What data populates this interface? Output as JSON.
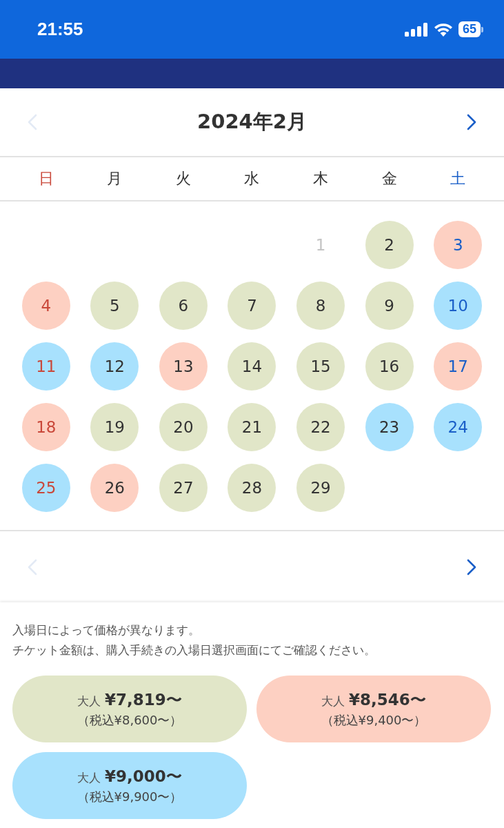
{
  "status_bar": {
    "time": "21:55",
    "battery": "65"
  },
  "calendar": {
    "month": "2024年2月",
    "prev_enabled": false,
    "next_enabled": true,
    "weekdays": [
      {
        "label": "日",
        "kind": "sunday"
      },
      {
        "label": "月",
        "kind": "weekday"
      },
      {
        "label": "火",
        "kind": "weekday"
      },
      {
        "label": "水",
        "kind": "weekday"
      },
      {
        "label": "木",
        "kind": "weekday"
      },
      {
        "label": "金",
        "kind": "weekday"
      },
      {
        "label": "土",
        "kind": "saturday"
      }
    ],
    "weeks": [
      [
        {
          "kind": "empty"
        },
        {
          "kind": "empty"
        },
        {
          "kind": "empty"
        },
        {
          "kind": "empty"
        },
        {
          "kind": "date",
          "day": "1",
          "disabled": true
        },
        {
          "kind": "date",
          "day": "2",
          "disabled": false,
          "color": "#e1e6c8"
        },
        {
          "kind": "date",
          "day": "3",
          "disabled": false,
          "color": "#fdd0c2"
        }
      ],
      [
        {
          "kind": "date",
          "day": "4",
          "disabled": false,
          "color": "#fdd0c2"
        },
        {
          "kind": "date",
          "day": "5",
          "disabled": false,
          "color": "#e1e6c8"
        },
        {
          "kind": "date",
          "day": "6",
          "disabled": false,
          "color": "#e1e6c8"
        },
        {
          "kind": "date",
          "day": "7",
          "disabled": false,
          "color": "#e1e6c8"
        },
        {
          "kind": "date",
          "day": "8",
          "disabled": false,
          "color": "#e1e6c8"
        },
        {
          "kind": "date",
          "day": "9",
          "disabled": false,
          "color": "#e1e6c8"
        },
        {
          "kind": "date",
          "day": "10",
          "disabled": false,
          "color": "#a8e1fd"
        }
      ],
      [
        {
          "kind": "date",
          "day": "11",
          "disabled": false,
          "color": "#a8e1fd"
        },
        {
          "kind": "date",
          "day": "12",
          "disabled": false,
          "color": "#a8e1fd"
        },
        {
          "kind": "date",
          "day": "13",
          "disabled": false,
          "color": "#fdd0c2"
        },
        {
          "kind": "date",
          "day": "14",
          "disabled": false,
          "color": "#e1e6c8"
        },
        {
          "kind": "date",
          "day": "15",
          "disabled": false,
          "color": "#e1e6c8"
        },
        {
          "kind": "date",
          "day": "16",
          "disabled": false,
          "color": "#e1e6c8"
        },
        {
          "kind": "date",
          "day": "17",
          "disabled": false,
          "color": "#fdd0c2"
        }
      ],
      [
        {
          "kind": "date",
          "day": "18",
          "disabled": false,
          "color": "#fdd0c2"
        },
        {
          "kind": "date",
          "day": "19",
          "disabled": false,
          "color": "#e1e6c8"
        },
        {
          "kind": "date",
          "day": "20",
          "disabled": false,
          "color": "#e1e6c8"
        },
        {
          "kind": "date",
          "day": "21",
          "disabled": false,
          "color": "#e1e6c8"
        },
        {
          "kind": "date",
          "day": "22",
          "disabled": false,
          "color": "#e1e6c8"
        },
        {
          "kind": "date",
          "day": "23",
          "disabled": false,
          "color": "#a8e1fd"
        },
        {
          "kind": "date",
          "day": "24",
          "disabled": false,
          "color": "#a8e1fd"
        }
      ],
      [
        {
          "kind": "date",
          "day": "25",
          "disabled": false,
          "color": "#a8e1fd"
        },
        {
          "kind": "date",
          "day": "26",
          "disabled": false,
          "color": "#fdd0c2"
        },
        {
          "kind": "date",
          "day": "27",
          "disabled": false,
          "color": "#e1e6c8"
        },
        {
          "kind": "date",
          "day": "28",
          "disabled": false,
          "color": "#e1e6c8"
        },
        {
          "kind": "date",
          "day": "29",
          "disabled": false,
          "color": "#e1e6c8"
        },
        {
          "kind": "empty"
        },
        {
          "kind": "empty"
        }
      ]
    ],
    "bottom_nav": {
      "prev_enabled": false,
      "next_enabled": true
    }
  },
  "notes": [
    "入場日によって価格が異なります。",
    "チケット金額は、購入手続きの入場日選択画面にてご確認ください。"
  ],
  "price_legend": [
    {
      "label": "大人",
      "price": "¥7,819〜",
      "tax_included": "（税込¥8,600〜）",
      "color": "#e1e6c8"
    },
    {
      "label": "大人",
      "price": "¥8,546〜",
      "tax_included": "（税込¥9,400〜）",
      "color": "#fdd0c2"
    },
    {
      "label": "大人",
      "price": "¥9,000〜",
      "tax_included": "（税込¥9,900〜）",
      "color": "#a8e1fd"
    }
  ]
}
